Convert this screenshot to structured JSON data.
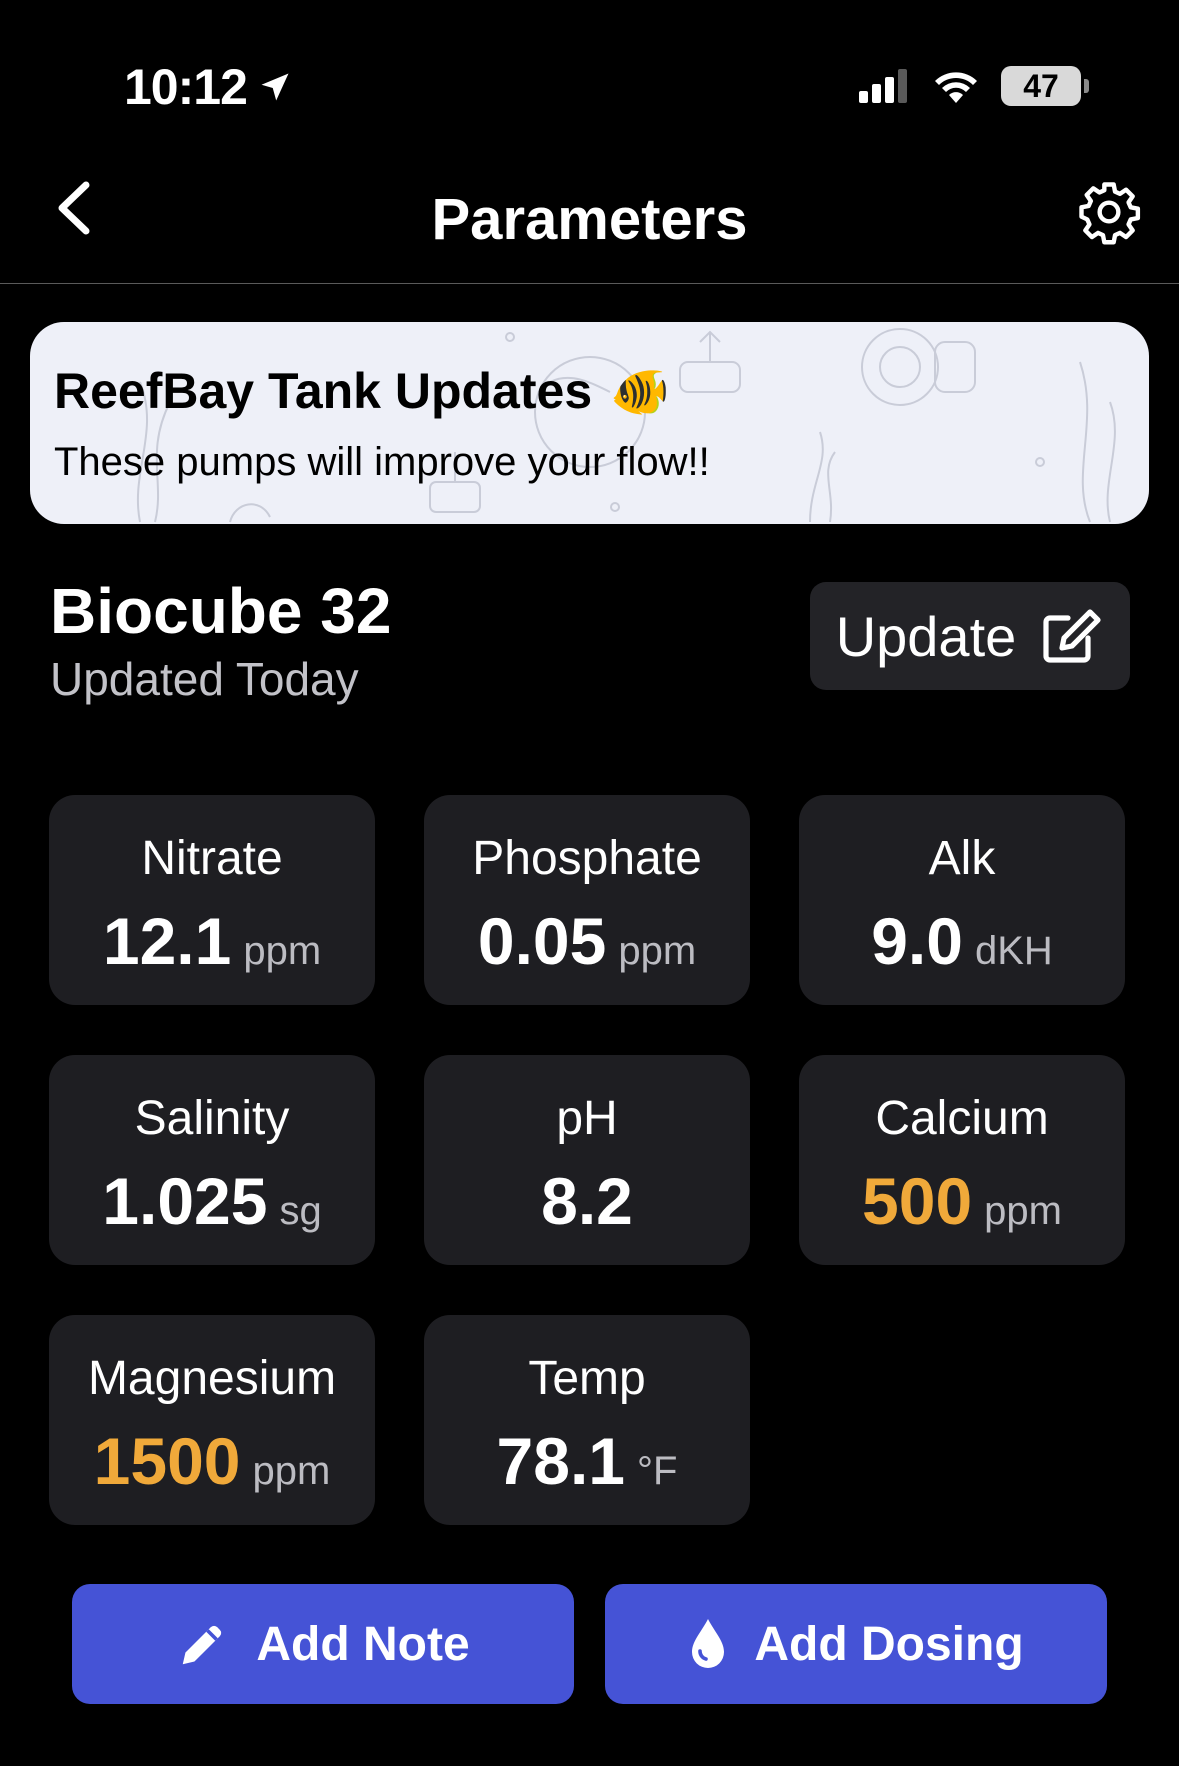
{
  "status_bar": {
    "time": "10:12",
    "battery": "47"
  },
  "nav": {
    "title": "Parameters"
  },
  "banner": {
    "title": "ReefBay Tank Updates",
    "subtitle": "These pumps will improve your flow!!",
    "emoji": "🐠"
  },
  "tank": {
    "name": "Biocube 32",
    "updated": "Updated Today",
    "update_label": "Update"
  },
  "parameters": [
    {
      "label": "Nitrate",
      "value": "12.1",
      "unit": "ppm",
      "status": "normal"
    },
    {
      "label": "Phosphate",
      "value": "0.05",
      "unit": "ppm",
      "status": "normal"
    },
    {
      "label": "Alk",
      "value": "9.0",
      "unit": "dKH",
      "status": "normal"
    },
    {
      "label": "Salinity",
      "value": "1.025",
      "unit": "sg",
      "status": "normal"
    },
    {
      "label": "pH",
      "value": "8.2",
      "unit": "",
      "status": "normal"
    },
    {
      "label": "Calcium",
      "value": "500",
      "unit": "ppm",
      "status": "warning"
    },
    {
      "label": "Magnesium",
      "value": "1500",
      "unit": "ppm",
      "status": "warning"
    },
    {
      "label": "Temp",
      "value": "78.1",
      "unit": "°F",
      "status": "normal"
    }
  ],
  "actions": {
    "add_note": "Add Note",
    "add_dosing": "Add Dosing"
  },
  "colors": {
    "accent": "#4553d6",
    "warning": "#f0a93a",
    "card": "#1e1e22"
  }
}
